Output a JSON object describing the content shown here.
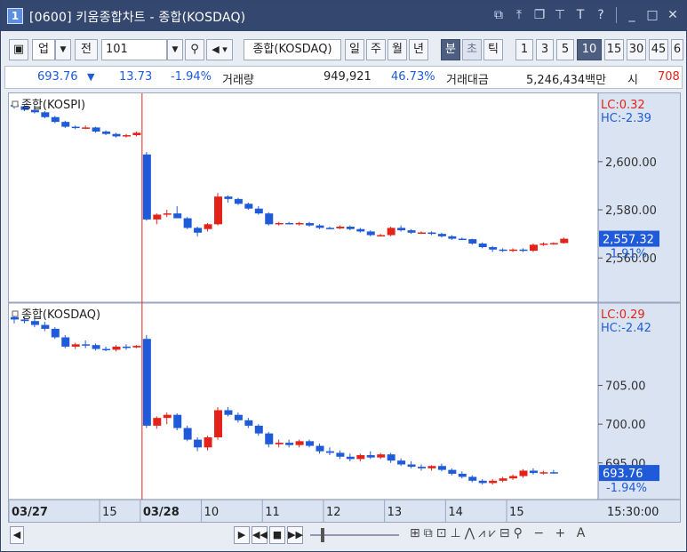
{
  "window": {
    "number": "1",
    "title": "[0600] 키움종합차트 - 종합(KOSDAQ)"
  },
  "toolbar": {
    "market": "업",
    "prev_label": "전",
    "code": "101",
    "name": "종합(KOSDAQ)",
    "periods": [
      "일",
      "주",
      "월",
      "년",
      "분",
      "초",
      "틱"
    ],
    "intervals": [
      "1",
      "3",
      "5",
      "10",
      "15",
      "30",
      "45",
      "6"
    ],
    "active_interval": "10"
  },
  "info": {
    "price": "693.76",
    "change": "13.73",
    "change_pct": "-1.94%",
    "volume_label": "거래량",
    "volume": "949,921",
    "volume_pct": "46.73%",
    "amount_label": "거래대금",
    "amount": "5,246,434백만",
    "open_label": "시",
    "open_value": "708"
  },
  "chart_data": [
    {
      "type": "candlestick",
      "title": "종합(KOSPI)",
      "lc": "LC:0.32",
      "hc": "HC:-2.39",
      "ytick_labels": [
        "2,600.00",
        "2,580.00",
        "2,560.00"
      ],
      "last_value": "2,557.32",
      "last_pct": "-1.91%",
      "ylim": [
        2542,
        2628
      ],
      "x_labels": [
        "03/27",
        "15",
        "03/28",
        "10",
        "11",
        "12",
        "13",
        "14",
        "15"
      ],
      "candles": [
        [
          2623.5,
          2624.5,
          2622.0,
          2623.0
        ],
        [
          2623.0,
          2623.5,
          2621.0,
          2621.5
        ],
        [
          2621.5,
          2622.0,
          2620.0,
          2620.5
        ],
        [
          2620.5,
          2621.0,
          2618.0,
          2618.5
        ],
        [
          2618.5,
          2619.0,
          2616.0,
          2616.5
        ],
        [
          2616.5,
          2617.0,
          2614.0,
          2614.5
        ],
        [
          2614.5,
          2615.0,
          2613.5,
          2614.0
        ],
        [
          2614.0,
          2615.0,
          2613.5,
          2614.2
        ],
        [
          2614.2,
          2614.5,
          2612.0,
          2612.5
        ],
        [
          2612.5,
          2613.0,
          2611.0,
          2611.5
        ],
        [
          2611.5,
          2612.0,
          2610.0,
          2610.5
        ],
        [
          2610.5,
          2611.5,
          2610.0,
          2611.0
        ],
        [
          2611.0,
          2612.5,
          2610.5,
          2612.0
        ],
        [
          2603.0,
          2604.0,
          2575.5,
          2576.0
        ],
        [
          2576.0,
          2578.5,
          2574.0,
          2578.0
        ],
        [
          2578.0,
          2580.0,
          2577.0,
          2578.5
        ],
        [
          2578.5,
          2581.5,
          2576.5,
          2576.5
        ],
        [
          2576.5,
          2577.0,
          2572.0,
          2572.5
        ],
        [
          2572.5,
          2573.0,
          2569.0,
          2570.5
        ],
        [
          2572.0,
          2574.5,
          2571.0,
          2574.0
        ],
        [
          2574.0,
          2587.0,
          2573.5,
          2585.5
        ],
        [
          2585.5,
          2586.0,
          2583.0,
          2584.5
        ],
        [
          2584.5,
          2585.0,
          2582.0,
          2582.5
        ],
        [
          2582.5,
          2583.0,
          2580.0,
          2580.5
        ],
        [
          2580.5,
          2581.5,
          2578.0,
          2578.5
        ],
        [
          2578.5,
          2579.0,
          2573.5,
          2574.0
        ],
        [
          2574.0,
          2575.0,
          2573.5,
          2574.5
        ],
        [
          2574.5,
          2575.0,
          2574.0,
          2574.0
        ],
        [
          2574.0,
          2575.0,
          2573.5,
          2574.5
        ],
        [
          2574.5,
          2575.0,
          2573.0,
          2573.5
        ],
        [
          2573.5,
          2574.0,
          2572.0,
          2572.5
        ],
        [
          2572.5,
          2573.0,
          2572.0,
          2572.3
        ],
        [
          2572.3,
          2573.5,
          2572.0,
          2573.0
        ],
        [
          2573.0,
          2573.5,
          2571.5,
          2572.0
        ],
        [
          2572.0,
          2572.5,
          2570.5,
          2571.0
        ],
        [
          2571.0,
          2571.5,
          2569.0,
          2569.5
        ],
        [
          2569.5,
          2570.0,
          2569.0,
          2569.5
        ],
        [
          2569.5,
          2573.0,
          2569.0,
          2572.5
        ],
        [
          2572.5,
          2573.5,
          2571.0,
          2571.5
        ],
        [
          2571.5,
          2572.0,
          2570.0,
          2570.5
        ],
        [
          2570.5,
          2571.0,
          2570.0,
          2570.6
        ],
        [
          2570.6,
          2571.0,
          2569.5,
          2570.0
        ],
        [
          2570.0,
          2570.5,
          2568.5,
          2569.0
        ],
        [
          2569.0,
          2569.5,
          2567.5,
          2568.0
        ],
        [
          2568.0,
          2568.5,
          2567.5,
          2567.8
        ],
        [
          2567.8,
          2568.0,
          2565.5,
          2566.0
        ],
        [
          2566.0,
          2566.5,
          2564.0,
          2564.5
        ],
        [
          2564.5,
          2565.0,
          2562.5,
          2563.5
        ],
        [
          2563.5,
          2564.0,
          2562.5,
          2563.0
        ],
        [
          2563.0,
          2564.0,
          2562.5,
          2563.5
        ],
        [
          2563.5,
          2564.0,
          2562.5,
          2563.0
        ],
        [
          2563.0,
          2566.0,
          2562.5,
          2565.5
        ],
        [
          2565.5,
          2566.5,
          2565.0,
          2566.0
        ],
        [
          2566.0,
          2566.5,
          2565.5,
          2566.2
        ],
        [
          2566.2,
          2568.5,
          2566.0,
          2568.0
        ]
      ]
    },
    {
      "type": "candlestick",
      "title": "종합(KOSDAQ)",
      "lc": "LC:0.29",
      "hc": "HC:-2.42",
      "ytick_labels": [
        "705.00",
        "700.00",
        "695.00"
      ],
      "last_value": "693.76",
      "last_pct": "-1.94%",
      "ylim": [
        690.5,
        715.5
      ],
      "candles": [
        [
          713.8,
          714.0,
          713.0,
          713.5
        ],
        [
          713.5,
          713.8,
          713.0,
          713.3
        ],
        [
          713.3,
          713.6,
          712.5,
          712.8
        ],
        [
          712.8,
          713.2,
          712.0,
          712.3
        ],
        [
          712.3,
          712.5,
          711.0,
          711.2
        ],
        [
          711.2,
          711.5,
          709.8,
          710.0
        ],
        [
          710.0,
          710.5,
          709.7,
          710.3
        ],
        [
          710.3,
          710.8,
          709.8,
          710.2
        ],
        [
          710.2,
          710.4,
          709.5,
          709.7
        ],
        [
          709.7,
          710.0,
          709.4,
          709.6
        ],
        [
          709.6,
          710.2,
          709.4,
          710.0
        ],
        [
          710.0,
          710.3,
          709.6,
          709.9
        ],
        [
          709.9,
          710.2,
          709.8,
          710.1
        ],
        [
          711.0,
          711.5,
          699.5,
          699.8
        ],
        [
          699.8,
          701.0,
          699.4,
          700.8
        ],
        [
          700.8,
          701.5,
          700.0,
          701.2
        ],
        [
          701.2,
          701.4,
          699.2,
          699.5
        ],
        [
          699.5,
          699.8,
          697.8,
          698.0
        ],
        [
          698.0,
          698.3,
          696.5,
          697.0
        ],
        [
          697.0,
          698.5,
          696.6,
          698.3
        ],
        [
          698.3,
          702.2,
          698.0,
          701.8
        ],
        [
          701.8,
          702.2,
          701.0,
          701.2
        ],
        [
          701.2,
          701.5,
          700.2,
          700.5
        ],
        [
          700.5,
          700.8,
          699.5,
          699.8
        ],
        [
          699.8,
          700.0,
          698.5,
          698.8
        ],
        [
          698.8,
          699.0,
          697.0,
          697.4
        ],
        [
          697.4,
          698.0,
          697.0,
          697.6
        ],
        [
          697.6,
          698.0,
          697.0,
          697.3
        ],
        [
          697.3,
          698.0,
          697.0,
          697.8
        ],
        [
          697.8,
          698.0,
          697.0,
          697.2
        ],
        [
          697.2,
          697.5,
          696.2,
          696.5
        ],
        [
          696.5,
          697.0,
          696.0,
          696.3
        ],
        [
          696.3,
          696.6,
          695.5,
          695.8
        ],
        [
          695.8,
          696.2,
          695.2,
          695.5
        ],
        [
          695.5,
          696.2,
          695.2,
          696.0
        ],
        [
          696.0,
          696.5,
          695.5,
          695.7
        ],
        [
          695.7,
          696.3,
          695.5,
          696.1
        ],
        [
          696.1,
          696.3,
          695.0,
          695.3
        ],
        [
          695.3,
          695.6,
          694.6,
          694.8
        ],
        [
          694.8,
          695.2,
          694.3,
          694.5
        ],
        [
          694.5,
          694.8,
          694.0,
          694.3
        ],
        [
          694.3,
          694.7,
          694.0,
          694.6
        ],
        [
          694.6,
          694.9,
          693.9,
          694.1
        ],
        [
          694.1,
          694.3,
          693.4,
          693.6
        ],
        [
          693.6,
          693.9,
          693.0,
          693.2
        ],
        [
          693.2,
          693.4,
          692.5,
          692.7
        ],
        [
          692.7,
          692.9,
          692.2,
          692.4
        ],
        [
          692.4,
          692.9,
          692.2,
          692.7
        ],
        [
          692.7,
          693.2,
          692.5,
          693.0
        ],
        [
          693.0,
          693.5,
          692.8,
          693.3
        ],
        [
          693.3,
          694.2,
          693.1,
          694.0
        ],
        [
          694.0,
          694.3,
          693.5,
          693.7
        ],
        [
          693.7,
          694.0,
          693.5,
          693.8
        ],
        [
          693.8,
          694.1,
          693.6,
          693.7
        ]
      ],
      "x_labels": [
        "03/27",
        "15",
        "03/28",
        "10",
        "11",
        "12",
        "13",
        "14",
        "15"
      ],
      "time_label": "15:30:00"
    }
  ],
  "colors": {
    "up": "#e3231a",
    "down": "#1f5bd8",
    "axis_bg": "#d9e3f1",
    "divider": "#e3231a"
  },
  "icons": [
    "window-restore-icon",
    "pin-icon",
    "copy-icon",
    "stamp-icon",
    "text-icon",
    "help-icon",
    "minimize-icon",
    "maximize-icon",
    "close-icon"
  ]
}
